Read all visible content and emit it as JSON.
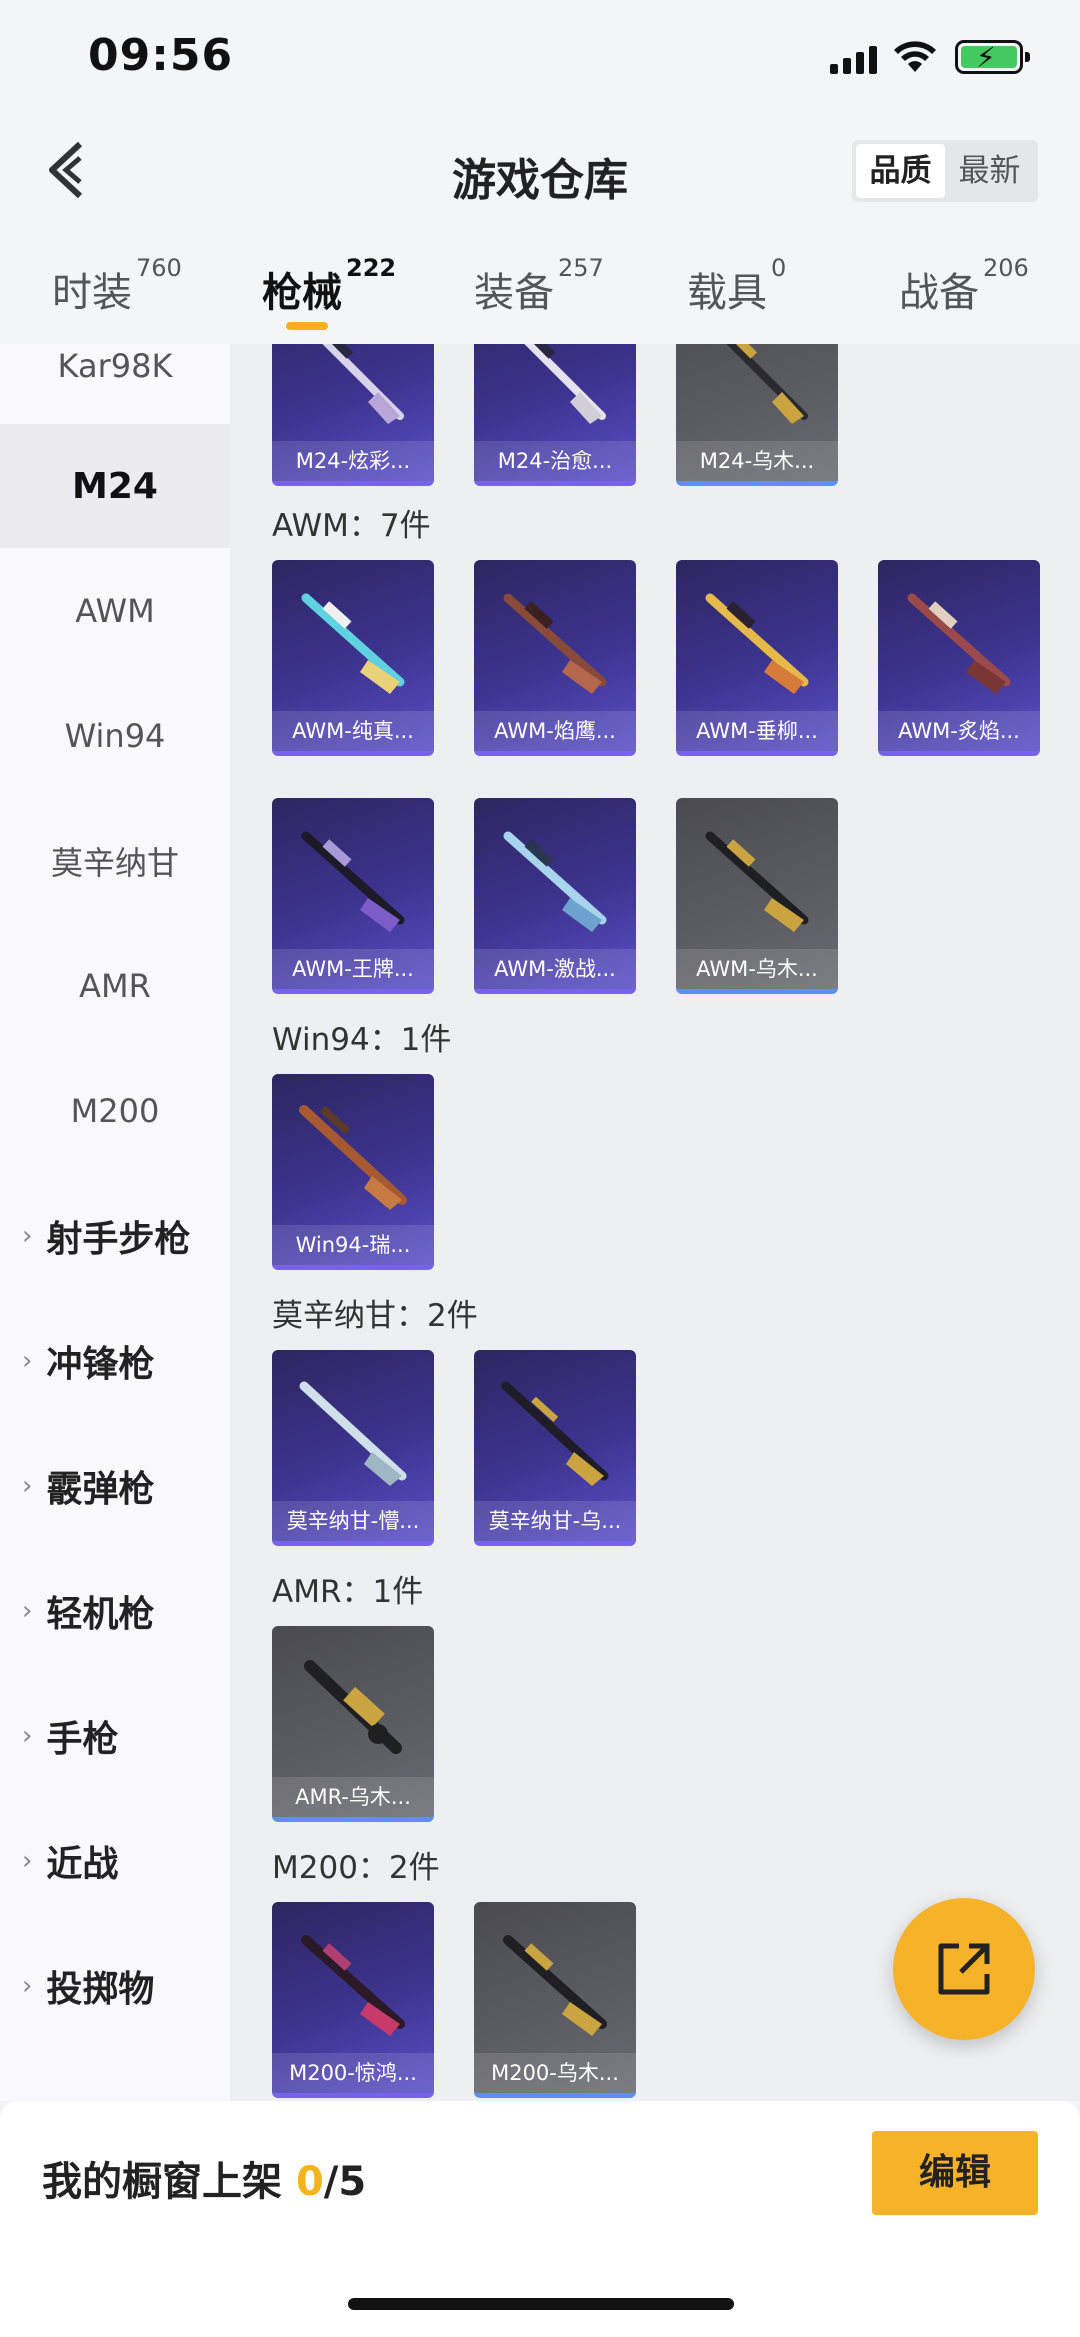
{
  "status_bar": {
    "time": "09:56"
  },
  "header": {
    "title": "游戏仓库",
    "sort_options": [
      "品质",
      "最新"
    ]
  },
  "tabs": [
    {
      "label": "时装",
      "count": "760"
    },
    {
      "label": "枪械",
      "count": "222"
    },
    {
      "label": "装备",
      "count": "257"
    },
    {
      "label": "载具",
      "count": "0"
    },
    {
      "label": "战备",
      "count": "206"
    }
  ],
  "sidebar": {
    "weapons": [
      "Kar98K",
      "M24",
      "AWM",
      "Win94",
      "莫辛纳甘",
      "AMR",
      "M200"
    ],
    "categories": [
      "射手步枪",
      "冲锋枪",
      "霰弹枪",
      "轻机枪",
      "手枪",
      "近战",
      "投掷物"
    ]
  },
  "content": {
    "m24_items": [
      "M24-炫彩...",
      "M24-治愈...",
      "M24-乌木..."
    ],
    "groups": {
      "awm": {
        "title": "AWM：7件",
        "items": [
          "AWM-纯真...",
          "AWM-焰鹰...",
          "AWM-垂柳...",
          "AWM-炙焰...",
          "AWM-王牌...",
          "AWM-激战...",
          "AWM-乌木..."
        ]
      },
      "win94": {
        "title": "Win94：1件",
        "items": [
          "Win94-瑞..."
        ]
      },
      "mosin": {
        "title": "莫辛纳甘：2件",
        "items": [
          "莫辛纳甘-懵...",
          "莫辛纳甘-乌..."
        ]
      },
      "amr": {
        "title": "AMR：1件",
        "items": [
          "AMR-乌木..."
        ]
      },
      "m200": {
        "title": "M200：2件",
        "items": [
          "M200-惊鸿...",
          "M200-乌木..."
        ]
      }
    }
  },
  "bottom": {
    "showcase_label": "我的橱窗上架",
    "current": "0",
    "total": "/5",
    "edit_label": "编辑"
  },
  "colors": {
    "accent": "#f6b229",
    "rare_purple": "#5b4fc7",
    "common_grey": "#5c5c63"
  }
}
